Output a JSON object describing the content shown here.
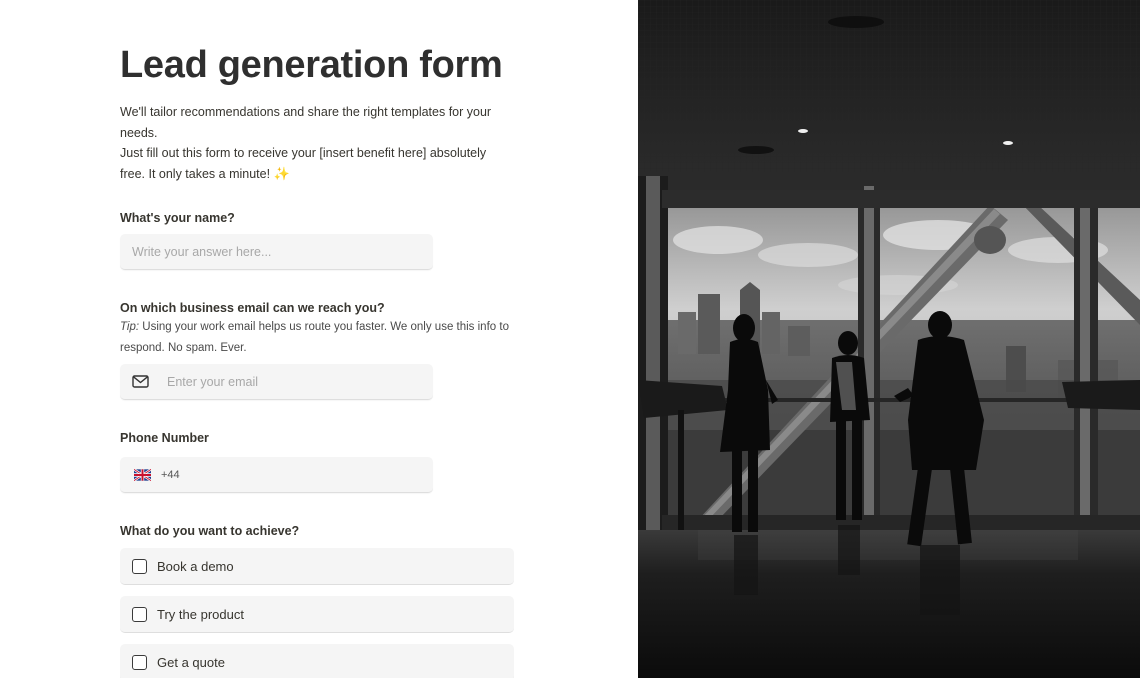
{
  "form": {
    "title": "Lead generation form",
    "intro_line1": "We'll tailor recommendations and share the right templates for your needs.",
    "intro_line2": "Just fill out this form to receive your [insert benefit here] absolutely free. It only takes a minute!",
    "questions": {
      "name": {
        "label": "What's your name?",
        "placeholder": "Write your answer here..."
      },
      "email": {
        "label": "On which business email can we reach you?",
        "tip_prefix": "Tip:",
        "tip_text": " Using your work email helps us route you faster. We only use this info to respond. No spam. Ever.",
        "placeholder": "Enter your email",
        "icon": "envelope-icon"
      },
      "phone": {
        "label": "Phone Number",
        "prefix": "+44",
        "flag": "uk-flag-icon"
      },
      "goal": {
        "label": "What do you want to achieve?",
        "options": [
          "Book a demo",
          "Try the product",
          "Get a quote"
        ]
      }
    }
  },
  "photo": {
    "description_icon": "office-silhouettes-photo"
  },
  "colors": {
    "field_bg": "#f5f5f5",
    "text": "#37352f",
    "placeholder": "#a8a8a8",
    "sparkle": "#f2b416"
  }
}
